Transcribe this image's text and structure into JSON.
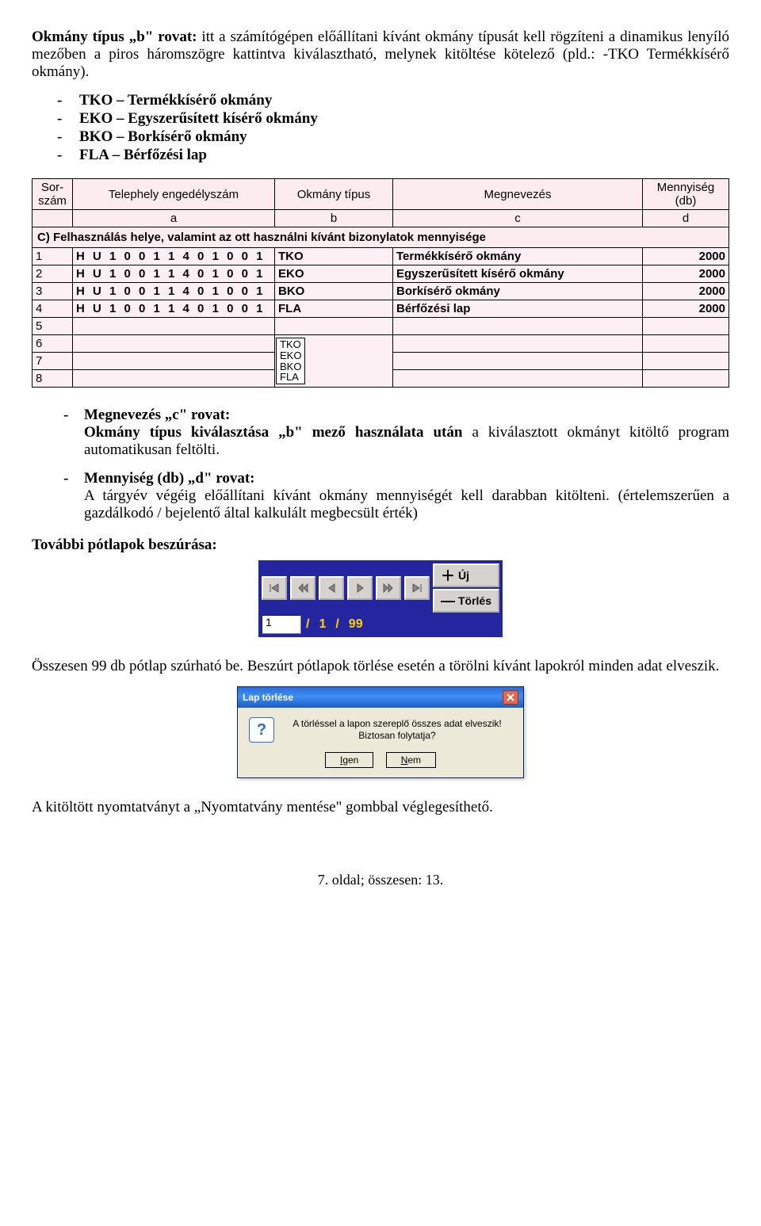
{
  "intro": {
    "run_in_bold": "Okmány típus „b\" rovat:",
    "rest": " itt a számítógépen előállítani kívánt okmány típusát kell rögzíteni a dinamikus lenyíló mezőben a piros háromszögre kattintva kiválasztható, melynek kitöltése kötelező (pld.: -TKO Termékkísérő okmány)."
  },
  "type_list": [
    "TKO – Termékkísérő okmány",
    "EKO – Egyszerűsített kísérő okmány",
    "BKO – Borkísérő okmány",
    "FLA  – Bérfőzési lap"
  ],
  "section_c": {
    "title": "C) Felhasználás helye, valamint az ott használni kívánt bizonylatok mennyisége",
    "headers": {
      "sor": "Sor-\nszám",
      "telephely": "Telephely engedélyszám",
      "okmany": "Okmány típus",
      "megnevezes": "Megnevezés",
      "mennyiseg": "Mennyiség\n(db)",
      "a": "a",
      "b": "b",
      "c": "c",
      "d": "d"
    },
    "rows": [
      {
        "n": "1",
        "lic": "H U 1 0 0 1 1 4 0 1 0 0 1",
        "typ": "TKO",
        "name": "Termékkísérő okmány",
        "qty": "2000"
      },
      {
        "n": "2",
        "lic": "H U 1 0 0 1 1 4 0 1 0 0 1",
        "typ": "EKO",
        "name": "Egyszerűsített kísérő okmány",
        "qty": "2000"
      },
      {
        "n": "3",
        "lic": "H U 1 0 0 1 1 4 0 1 0 0 1",
        "typ": "BKO",
        "name": "Borkísérő okmány",
        "qty": "2000"
      },
      {
        "n": "4",
        "lic": "H U 1 0 0 1 1 4 0 1 0 0 1",
        "typ": "FLA",
        "name": "Bérfőzési lap",
        "qty": "2000"
      }
    ],
    "empty_rows": [
      "5",
      "7",
      "8"
    ],
    "dropdown_row": "6",
    "dropdown_opts": [
      "TKO",
      "EKO",
      "BKO",
      "FLA"
    ]
  },
  "rovat": {
    "c": {
      "title": "Megnevezés „c\" rovat:",
      "body_pre": "Okmány típus kiválasztása „b\" mező használata után",
      "body_rest": " a kiválasztott okmányt kitöltő program automatikusan feltölti."
    },
    "d": {
      "title": "Mennyiség (db) „d\" rovat:",
      "body": "A tárgyév végéig előállítani kívánt okmány mennyiségét kell darabban kitölteni. (értelemszerűen a gazdálkodó / bejelentő által kalkulált megbecsült érték)"
    }
  },
  "potlap_heading": "További pótlapok beszúrása:",
  "navigator": {
    "input": "1",
    "current": "1",
    "total": "99",
    "new_label": "Új",
    "del_label": "Törlés"
  },
  "potlap_summary": "Összesen 99 db pótlap szúrható be. Beszúrt pótlapok törlése esetén a törölni kívánt lapokról minden adat elveszik.",
  "dialog": {
    "title": "Lap törlése",
    "line1": "A törléssel a lapon szereplő összes adat elveszik!",
    "line2": "Biztosan folytatja?",
    "yes": "Igen",
    "no": "Nem"
  },
  "final_para": "A kitöltött nyomtatványt a „Nyomtatvány mentése\" gombbal véglegesíthető.",
  "footer": "7. oldal; összesen: 13."
}
